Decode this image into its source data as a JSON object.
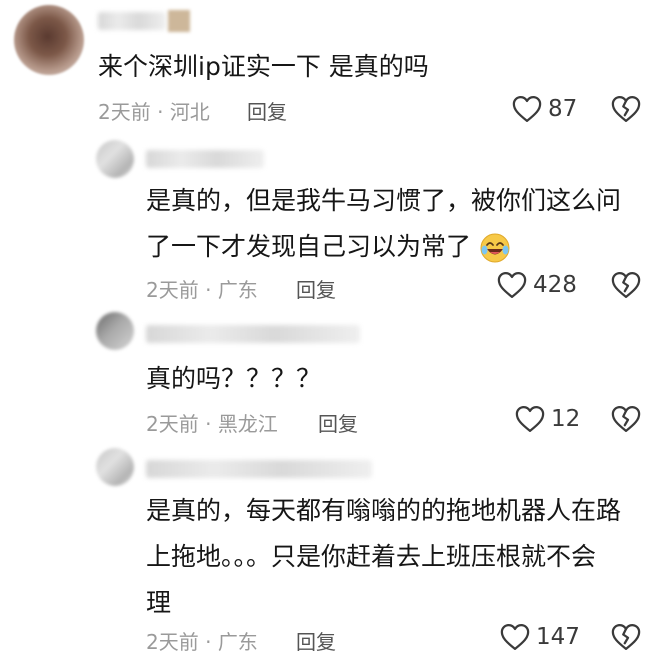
{
  "comments": [
    {
      "text_lines": [
        "来个深圳ip证实一下 是真的吗"
      ],
      "time": "2天前",
      "location": "河北",
      "reply": "回复",
      "likes": "87"
    },
    {
      "text_lines": [
        "是真的，但是我牛马习惯了，被你们这么问",
        "了一下才发现自己习以为常了"
      ],
      "time": "2天前",
      "location": "广东",
      "reply": "回复",
      "likes": "428"
    },
    {
      "text_lines": [
        "真的吗？？？？"
      ],
      "time": "2天前",
      "location": "黑龙江",
      "reply": "回复",
      "likes": "12"
    },
    {
      "text_lines": [
        "是真的，每天都有嗡嗡的的拖地机器人在路",
        "上拖地。。。只是你赶着去上班压根就不会",
        "理"
      ],
      "time": "2天前",
      "location": "广东",
      "reply": "回复",
      "likes": "147"
    }
  ],
  "meta_separator": "·",
  "icons": {
    "like": "heart-outline-icon",
    "dislike": "broken-heart-icon",
    "emoji": "laughing-crying-emoji-icon"
  },
  "colors": {
    "text": "#161616",
    "meta": "#9a9a9a",
    "reply": "#555555",
    "count": "#3a3a3a",
    "emoji": "#f7c948"
  }
}
